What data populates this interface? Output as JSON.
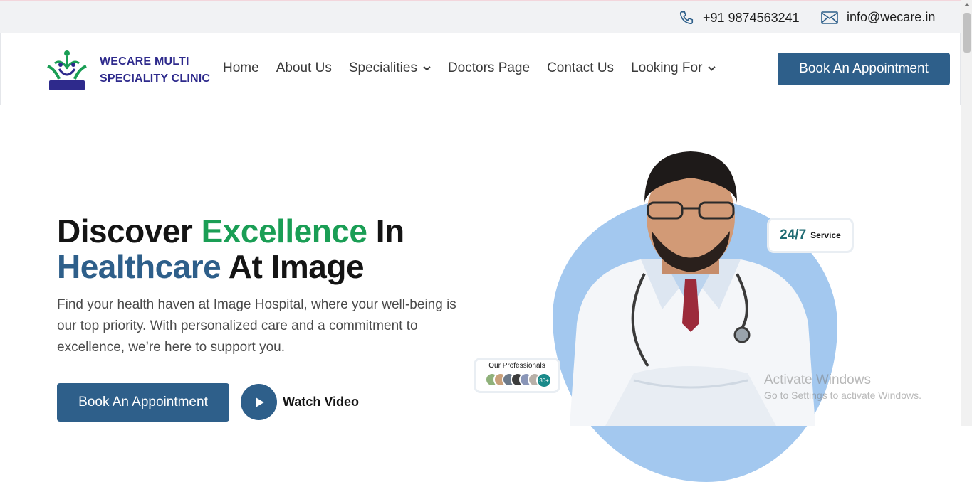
{
  "topbar": {
    "phone": "+91 9874563241",
    "phone_icon": "phone-icon",
    "email": "info@wecare.in",
    "email_icon": "mail-icon"
  },
  "header": {
    "brand_line1": "WECARE MULTI",
    "brand_line2": "SPECIALITY CLINIC",
    "logo_text": "WECARE MULTI SPECIALITY CLINIC",
    "nav": [
      {
        "label": "Home"
      },
      {
        "label": "About Us"
      },
      {
        "label": "Specialities",
        "dropdown": true
      },
      {
        "label": "Doctors Page"
      },
      {
        "label": "Contact Us"
      },
      {
        "label": "Looking For",
        "dropdown": true
      }
    ],
    "cta": "Book An Appointment"
  },
  "hero": {
    "title_part1": "Discover ",
    "title_part2": "Excellence",
    "title_part3": " In",
    "title_part4": "Healthcare",
    "title_part5": " At Image",
    "description": "Find your health haven at Image Hospital, where your well-being is our top priority. With personalized care and a commitment to excellence, we’re here to support you.",
    "book_button": "Book An Appointment",
    "watch_video": "Watch Video",
    "badge_247_big": "24/7",
    "badge_247_small": "Service",
    "professionals_label": "Our Professionals",
    "professionals_count": "30+"
  },
  "watermark": {
    "line1": "Activate Windows",
    "line2": "Go to Settings to activate Windows."
  },
  "colors": {
    "accent_blue": "#2e5f8a",
    "accent_green": "#1a9e55",
    "brand_purple": "#2e2a8c",
    "blob": "#a3c8ef"
  }
}
